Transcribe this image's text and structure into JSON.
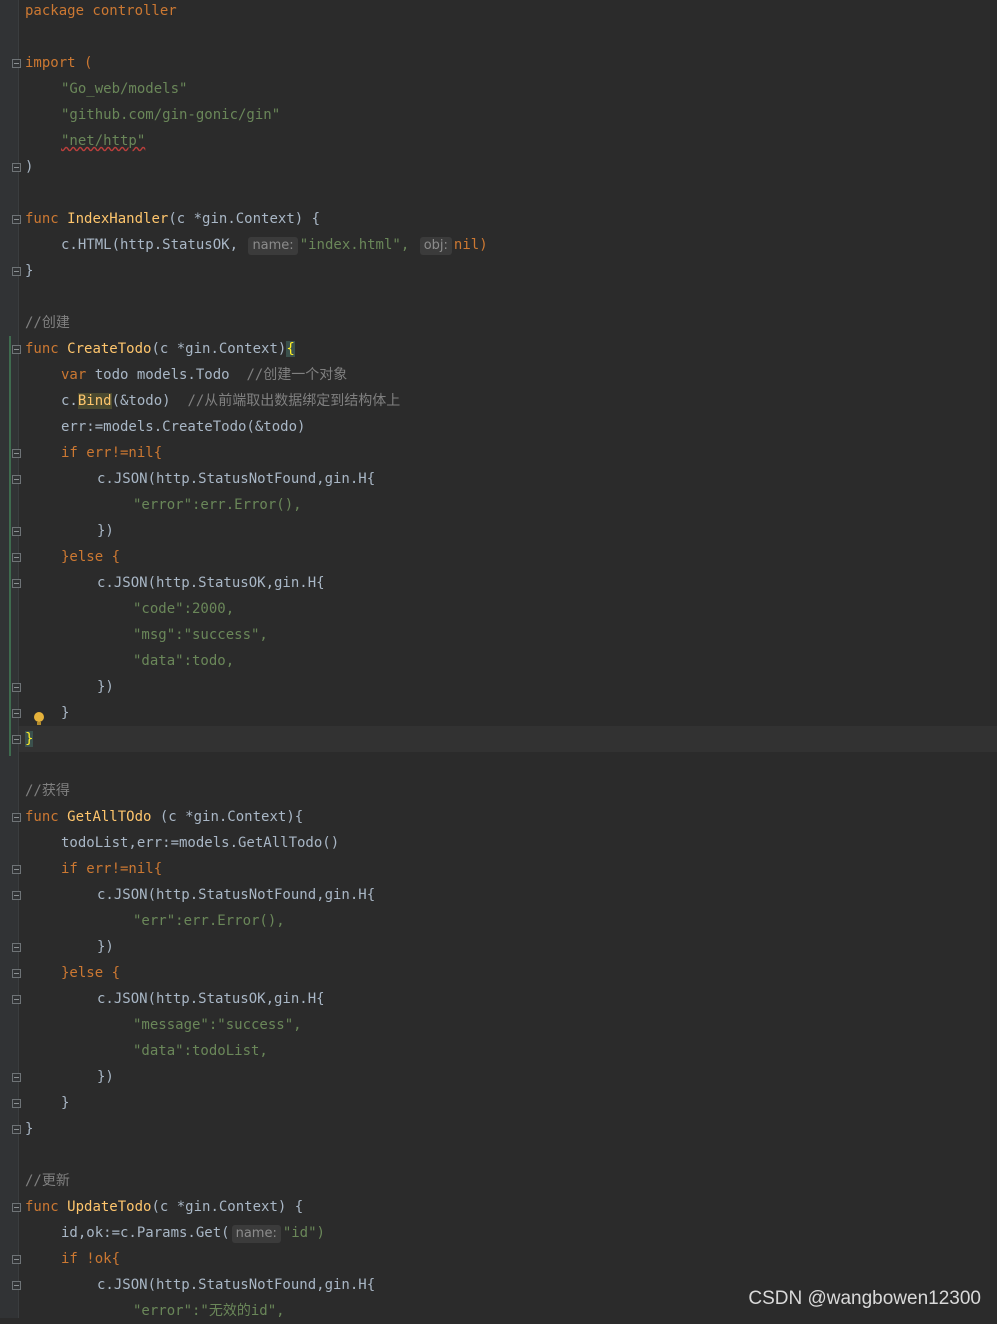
{
  "code": {
    "l0": "package controller",
    "l_import": "import (",
    "imp1": "\"Go_web/models\"",
    "imp2": "\"github.com/gin-gonic/gin\"",
    "imp3": "\"net/http\"",
    "close_paren": ")",
    "f1_sig_kw": "func ",
    "f1_name": "IndexHandler",
    "f1_params": "(c *gin.Context) {",
    "f1_body_a": "c.HTML(http.StatusOK, ",
    "f1_hint_name": "name:",
    "f1_body_b": "\"index.html\",",
    "f1_hint_obj": "obj:",
    "f1_body_c": "nil)",
    "close_brace": "}",
    "c_create": "//创建",
    "f2_name": "CreateTodo",
    "f2_params": "(c *gin.Context)",
    "f2_open": "{",
    "f2_l1a": "var ",
    "f2_l1b": "todo models.Todo  ",
    "f2_l1c": "//创建一个对象",
    "f2_l2a": "c.",
    "f2_l2b": "Bind",
    "f2_l2c": "(&todo)  ",
    "f2_l2d": "//从前端取出数据绑定到结构体上",
    "f2_l3": "err:=models.CreateTodo(&todo)",
    "if_err": "if err!=nil{",
    "json_notfound": "c.JSON(http.StatusNotFound,gin.H{",
    "f2_err_line": "\"error\":err.Error(),",
    "close_json": "})",
    "else_line": "}else {",
    "json_ok": "c.JSON(http.StatusOK,gin.H{",
    "f2_code": "\"code\":2000,",
    "f2_msg": "\"msg\":\"success\",",
    "f2_data": "\"data\":todo,",
    "inner_close": "}",
    "c_get": "//获得",
    "f3_name": "GetAllTOdo",
    "f3_params": " (c *gin.Context){",
    "f3_l1": "todoList,err:=models.GetAllTodo()",
    "f3_err_line": "\"err\":err.Error(),",
    "f3_message": "\"message\":\"success\",",
    "f3_data": "\"data\":todoList,",
    "c_update": "//更新",
    "f4_name": "UpdateTodo",
    "f4_params": "(c *gin.Context) {",
    "f4_l1a": "id,ok:=c.Params.Get(",
    "f4_hint": "name:",
    "f4_l1b": "\"id\")",
    "f4_if": "if !ok{",
    "f4_err_line": "\"error\":\"无效的id\","
  },
  "watermark": "CSDN @wangbowen12300",
  "colors": {
    "background": "#2b2b2b",
    "keyword": "#cc7832",
    "string": "#6a8759",
    "function": "#ffc66d",
    "comment": "#808080"
  },
  "icons": [
    "fold-marker-icon",
    "lightbulb-icon"
  ]
}
